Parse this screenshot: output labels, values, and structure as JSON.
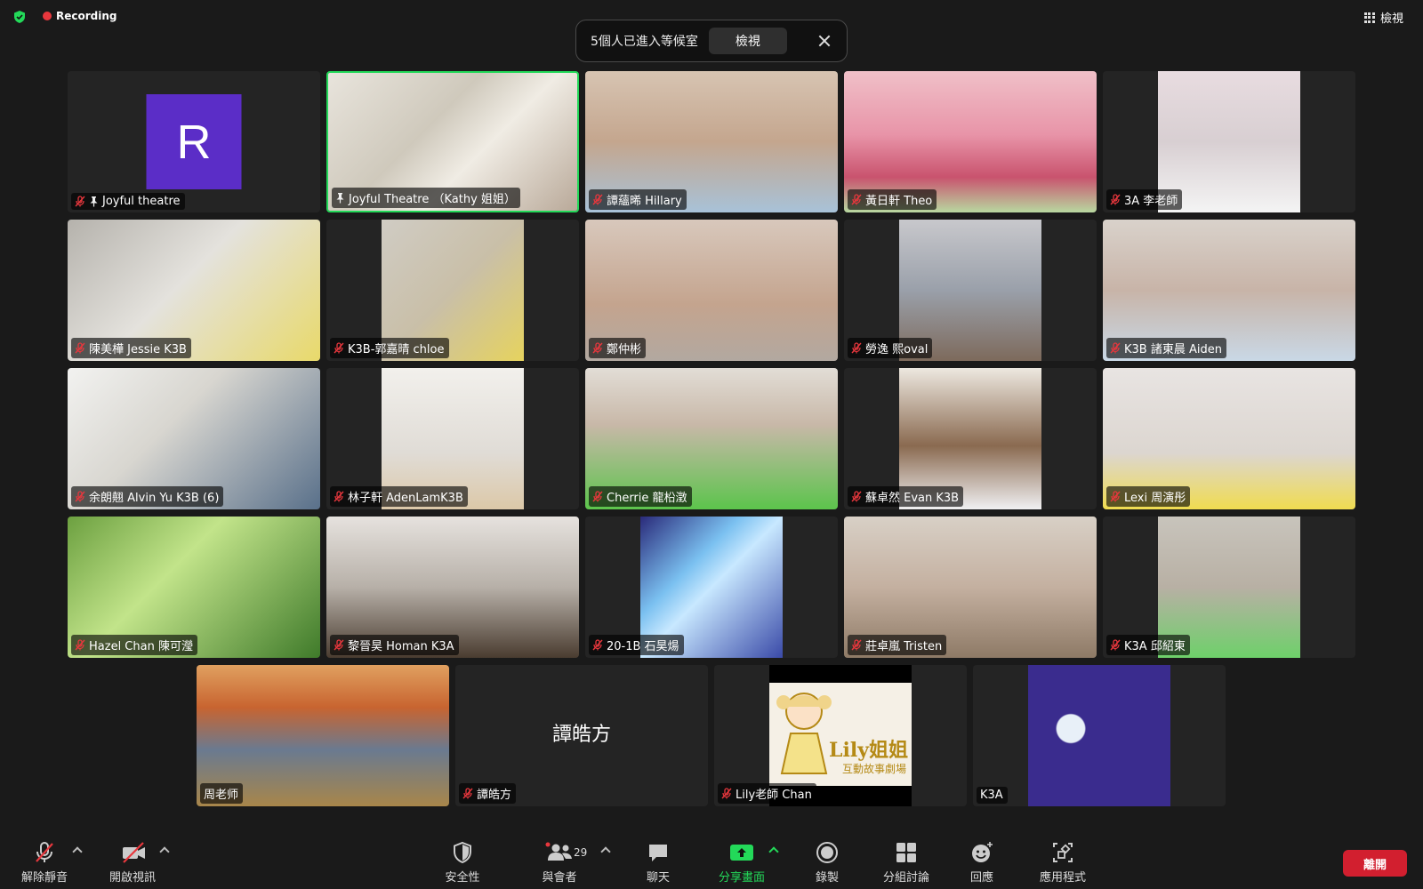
{
  "recording": {
    "label": "Recording",
    "color": "#e8373d"
  },
  "header": {
    "view_label": "檢視"
  },
  "waiting_room": {
    "message": "5個人已進入等候室",
    "view_button": "檢視"
  },
  "tiles": [
    {
      "name": "Joyful theatre",
      "avatar": "R",
      "avatar_color": "#5b2dc7",
      "muted": true,
      "pinned": true
    },
    {
      "name": "Joyful Theatre （Kathy 姐姐）",
      "muted": false,
      "pinned": true,
      "active_speaker": true
    },
    {
      "name": "譚蘊晞 Hillary",
      "muted": true
    },
    {
      "name": "黃日軒 Theo",
      "muted": true
    },
    {
      "name": "3A 李老師",
      "muted": true
    },
    {
      "name": "陳美樺 Jessie K3B",
      "muted": true
    },
    {
      "name": "K3B-郭嘉晴 chloe",
      "muted": true
    },
    {
      "name": "鄭仲彬",
      "muted": true
    },
    {
      "name": "勞逸 熙oval",
      "muted": true
    },
    {
      "name": "K3B 諸東晨 Aiden",
      "muted": true
    },
    {
      "name": "余朗翹 Alvin Yu K3B (6)",
      "muted": true
    },
    {
      "name": "林子軒 AdenLamK3B",
      "muted": true
    },
    {
      "name": "Cherrie 龍柗澂",
      "muted": true
    },
    {
      "name": "蘇卓然 Evan K3B",
      "muted": true
    },
    {
      "name": "Lexi 周演彤",
      "muted": true
    },
    {
      "name": "Hazel Chan 陳可瀅",
      "muted": true
    },
    {
      "name": "黎晉昊 Homan K3A",
      "muted": true
    },
    {
      "name": "20-1B 石昊煬",
      "muted": true
    },
    {
      "name": "莊卓嵐 Tristen",
      "muted": true
    },
    {
      "name": "K3A 邱紹東",
      "muted": true
    },
    {
      "name": "周老师",
      "muted": false
    },
    {
      "name": "譚皓方",
      "muted": true,
      "video_off_label": "譚皓方"
    },
    {
      "name": "Lily老師 Chan",
      "muted": true,
      "logo_text": "Lily姐姐",
      "logo_subtext": "互動故事劇場"
    },
    {
      "name": "K3A",
      "muted": false
    }
  ],
  "toolbar": {
    "unmute": "解除靜音",
    "start_video": "開啟視訊",
    "security": "安全性",
    "participants": "與會者",
    "participant_count": "29",
    "chat": "聊天",
    "share_screen": "分享畫面",
    "record": "錄製",
    "breakout": "分組討論",
    "reactions": "回應",
    "apps": "應用程式",
    "leave": "離開"
  }
}
